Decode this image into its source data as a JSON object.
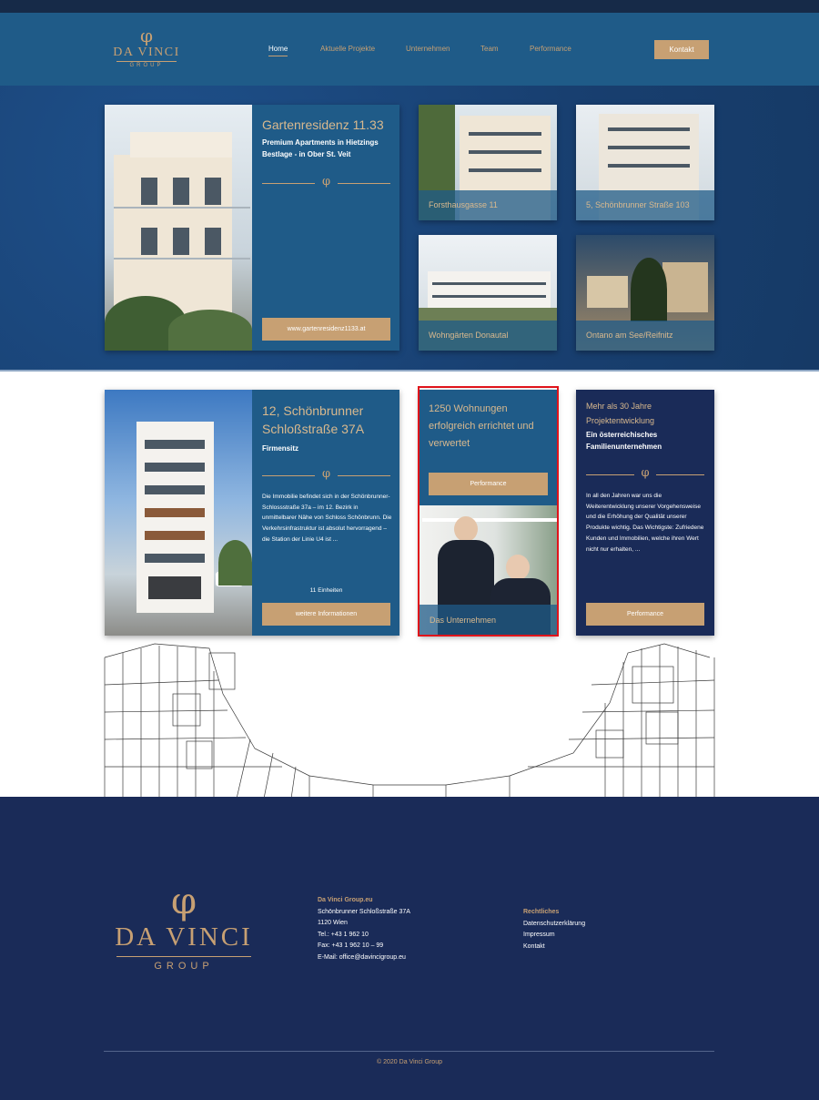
{
  "brand": {
    "logo_symbol": "φ",
    "name": "DA VINCI",
    "group": "GROUP"
  },
  "nav": {
    "items": [
      {
        "label": "Home",
        "active": true
      },
      {
        "label": "Aktuelle Projekte"
      },
      {
        "label": "Unternehmen"
      },
      {
        "label": "Team"
      },
      {
        "label": "Performance"
      }
    ],
    "contact_label": "Kontakt"
  },
  "featured": {
    "title": "Gartenresidenz 11.33",
    "subtitle": "Premium Apartments in Hietzings Bestlage - in Ober St. Veit",
    "button": "www.gartenresidenz1133.at"
  },
  "projects": [
    {
      "label": "Forsthausgasse 11"
    },
    {
      "label": "5, Schönbrunner Straße 103"
    },
    {
      "label": "Wohngärten Donautal"
    },
    {
      "label": "Ontano am See/Reifnitz"
    }
  ],
  "office_card": {
    "title": "12, Schönbrunner Schloßstraße 37A",
    "subtitle": "Firmensitz",
    "body": "Die Immobilie befindet sich in der Schönbrunner-Schlossstraße 37a – im 12. Bezirk in unmittelbarer Nähe von Schloss Schönbrunn. Die Verkehrsinfrastruktur ist absolut hervorragend – die Station der Linie U4 ist ...",
    "units": "11 Einheiten",
    "button": "weitere Informationen"
  },
  "stats_card": {
    "title": "1250 Wohnungen erfolgreich errichtet und verwertet",
    "button": "Performance",
    "image_label": "Das Unternehmen"
  },
  "history_card": {
    "title": "Mehr als 30 Jahre Projektentwicklung",
    "subtitle": "Ein österreichisches Familienunternehmen",
    "body": "In all den Jahren war uns die Weiterentwicklung unserer Vorgehensweise und die Erhöhung der Qualität unserer Produkte wichtig. Das Wichtigste: Zufriedene Kunden und Immobilien, welche ihren Wert nicht nur erhalten, ...",
    "button": "Performance"
  },
  "footer": {
    "address": {
      "heading": "Da Vinci Group.eu",
      "lines": [
        "Schönbrunner Schloßstraße 37A",
        "1120 Wien",
        "Tel.: +43 1 962 10",
        "Fax: +43 1 962 10 – 99",
        "E-Mail: office@davincigroup.eu"
      ]
    },
    "legal": {
      "heading": "Rechtliches",
      "links": [
        "Datenschutzerklärung",
        "Impressum",
        "Kontakt"
      ]
    },
    "copyright": "© 2020 Da Vinci Group"
  },
  "colors": {
    "accent_gold": "#c7a073",
    "header_blue": "#1f5b88",
    "navy": "#1a2b58",
    "highlight": "#e0141b"
  }
}
